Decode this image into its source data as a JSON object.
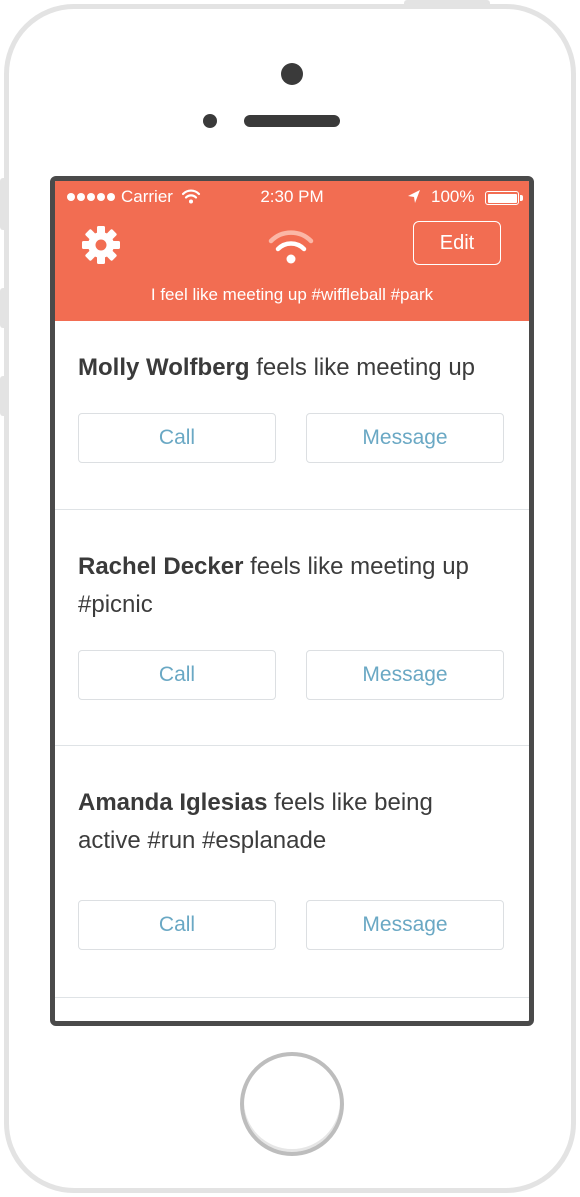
{
  "status_bar": {
    "carrier": "Carrier",
    "time": "2:30 PM",
    "battery": "100%",
    "signal_icon": "signal-dots-icon",
    "wifi_icon": "wifi-icon",
    "location_icon": "location-arrow-icon",
    "battery_icon": "battery-full-icon"
  },
  "header": {
    "settings_icon": "gear-icon",
    "status_icon": "wifi-broadcast-icon",
    "edit_label": "Edit",
    "status_line": "I feel like meeting up #wiffleball #park"
  },
  "feed": [
    {
      "name": "Molly Wolfberg",
      "line1": " feels like meeting up",
      "line2": "",
      "call_label": "Call",
      "message_label": "Message"
    },
    {
      "name": "Rachel Decker",
      "line1": " feels like meeting up",
      "line2": "#picnic",
      "call_label": "Call",
      "message_label": "Message"
    },
    {
      "name": "Amanda Iglesias",
      "line1": " feels like being",
      "line2": "active #run #esplanade",
      "call_label": "Call",
      "message_label": "Message"
    }
  ],
  "colors": {
    "header_bg": "#f26d52",
    "button_text": "#6aa8c4",
    "divider": "#dfe3e6"
  }
}
